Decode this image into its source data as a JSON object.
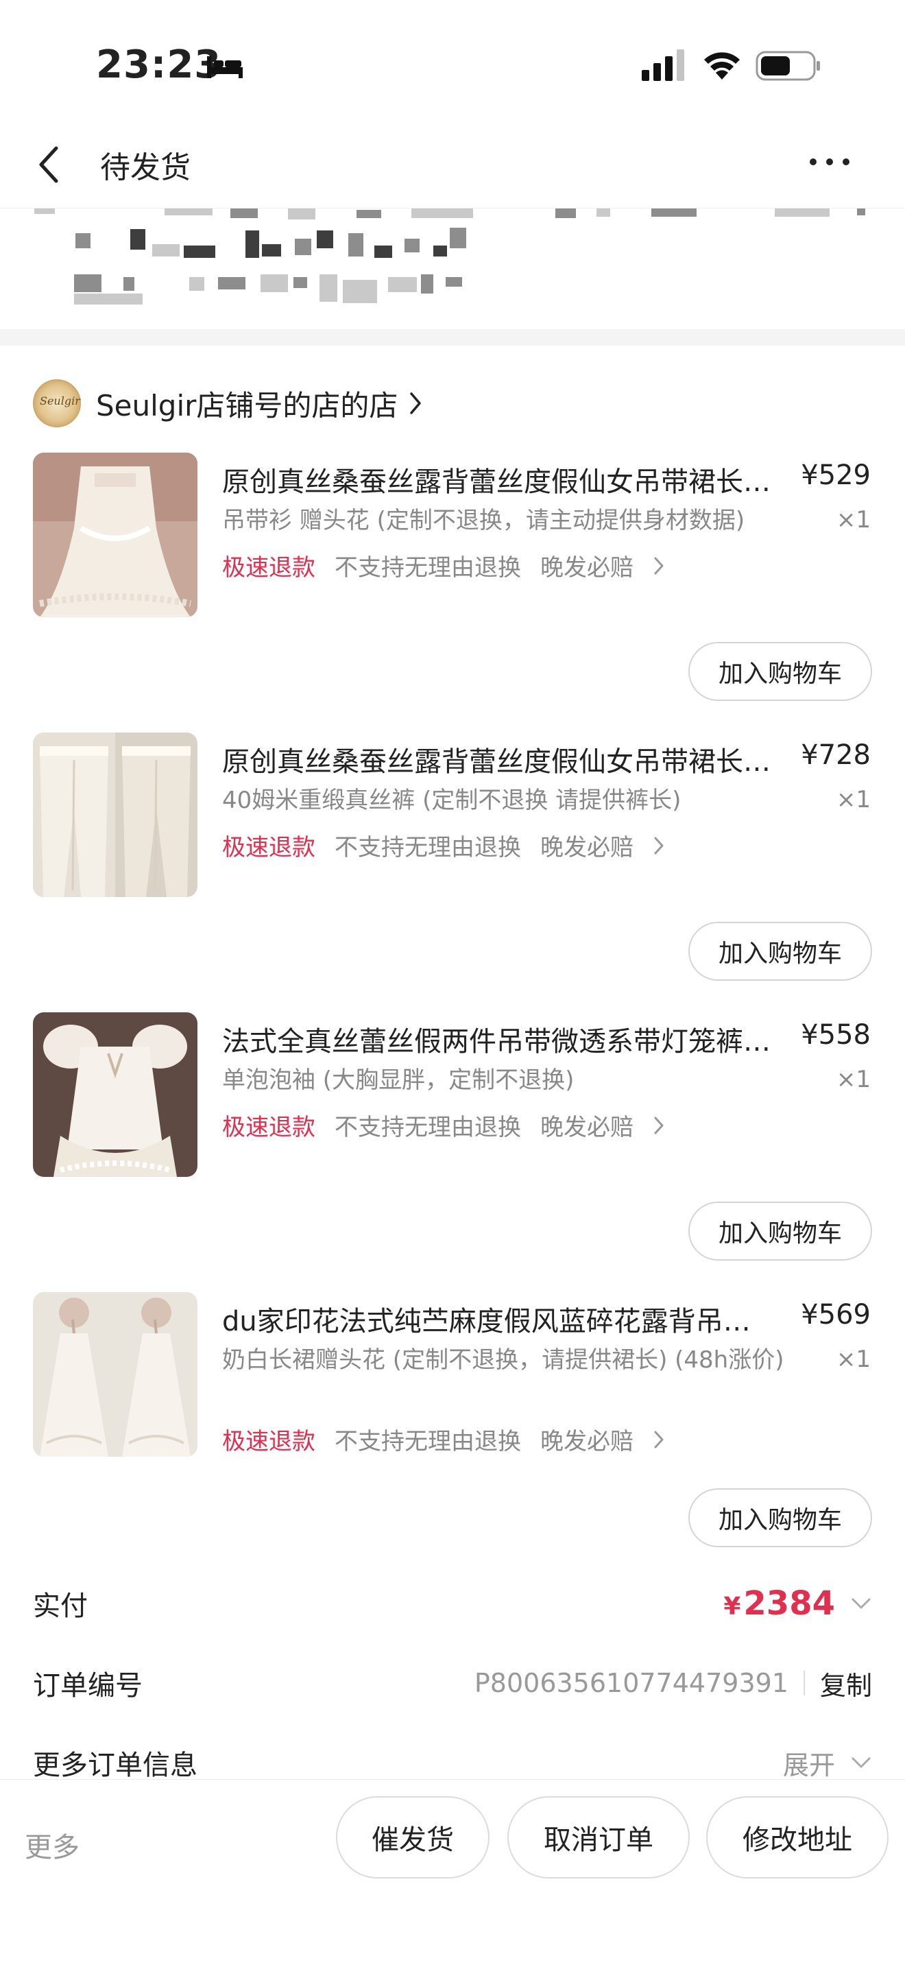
{
  "status_bar": {
    "time": "23:23"
  },
  "nav": {
    "title": "待发货"
  },
  "store": {
    "name": "Seulgir店铺号的店的店",
    "logo_text": "Seulgir"
  },
  "items": [
    {
      "title": "原创真丝桑蚕丝露背蕾丝度假仙女吊带裙长…",
      "price": "¥529",
      "spec": "吊带衫 赠头花 (定制不退换，请主动提供身材数据)",
      "qty": "×1",
      "tag_refund": "极速退款",
      "tag_noreason": "不支持无理由退换",
      "tag_late": "晚发必赔",
      "cart_label": "加入购物车"
    },
    {
      "title": "原创真丝桑蚕丝露背蕾丝度假仙女吊带裙长…",
      "price": "¥728",
      "spec": "40姆米重缎真丝裤 (定制不退换 请提供裤长)",
      "qty": "×1",
      "tag_refund": "极速退款",
      "tag_noreason": "不支持无理由退换",
      "tag_late": "晚发必赔",
      "cart_label": "加入购物车"
    },
    {
      "title": "法式全真丝蕾丝假两件吊带微透系带灯笼裤…",
      "price": "¥558",
      "spec": "单泡泡袖 (大胸显胖，定制不退换)",
      "qty": "×1",
      "tag_refund": "极速退款",
      "tag_noreason": "不支持无理由退换",
      "tag_late": "晚发必赔",
      "cart_label": "加入购物车"
    },
    {
      "title": "du家印花法式纯苎麻度假风蓝碎花露背吊…",
      "price": "¥569",
      "spec": "奶白长裙赠头花 (定制不退换，请提供裙长) (48h涨价)",
      "qty": "×1",
      "tag_refund": "极速退款",
      "tag_noreason": "不支持无理由退换",
      "tag_late": "晚发必赔",
      "cart_label": "加入购物车"
    }
  ],
  "order": {
    "paid_label": "实付",
    "paid_currency": "¥",
    "paid_amount": "2384",
    "order_no_label": "订单编号",
    "order_no": "P800635610774479391",
    "copy_label": "复制",
    "more_info_label": "更多订单信息",
    "expand_label": "展开"
  },
  "bottom_bar": {
    "more_label": "更多",
    "urge_label": "催发货",
    "cancel_label": "取消订单",
    "address_label": "修改地址"
  },
  "colors": {
    "accent_red": "#e0304f",
    "muted_text": "#888888"
  }
}
